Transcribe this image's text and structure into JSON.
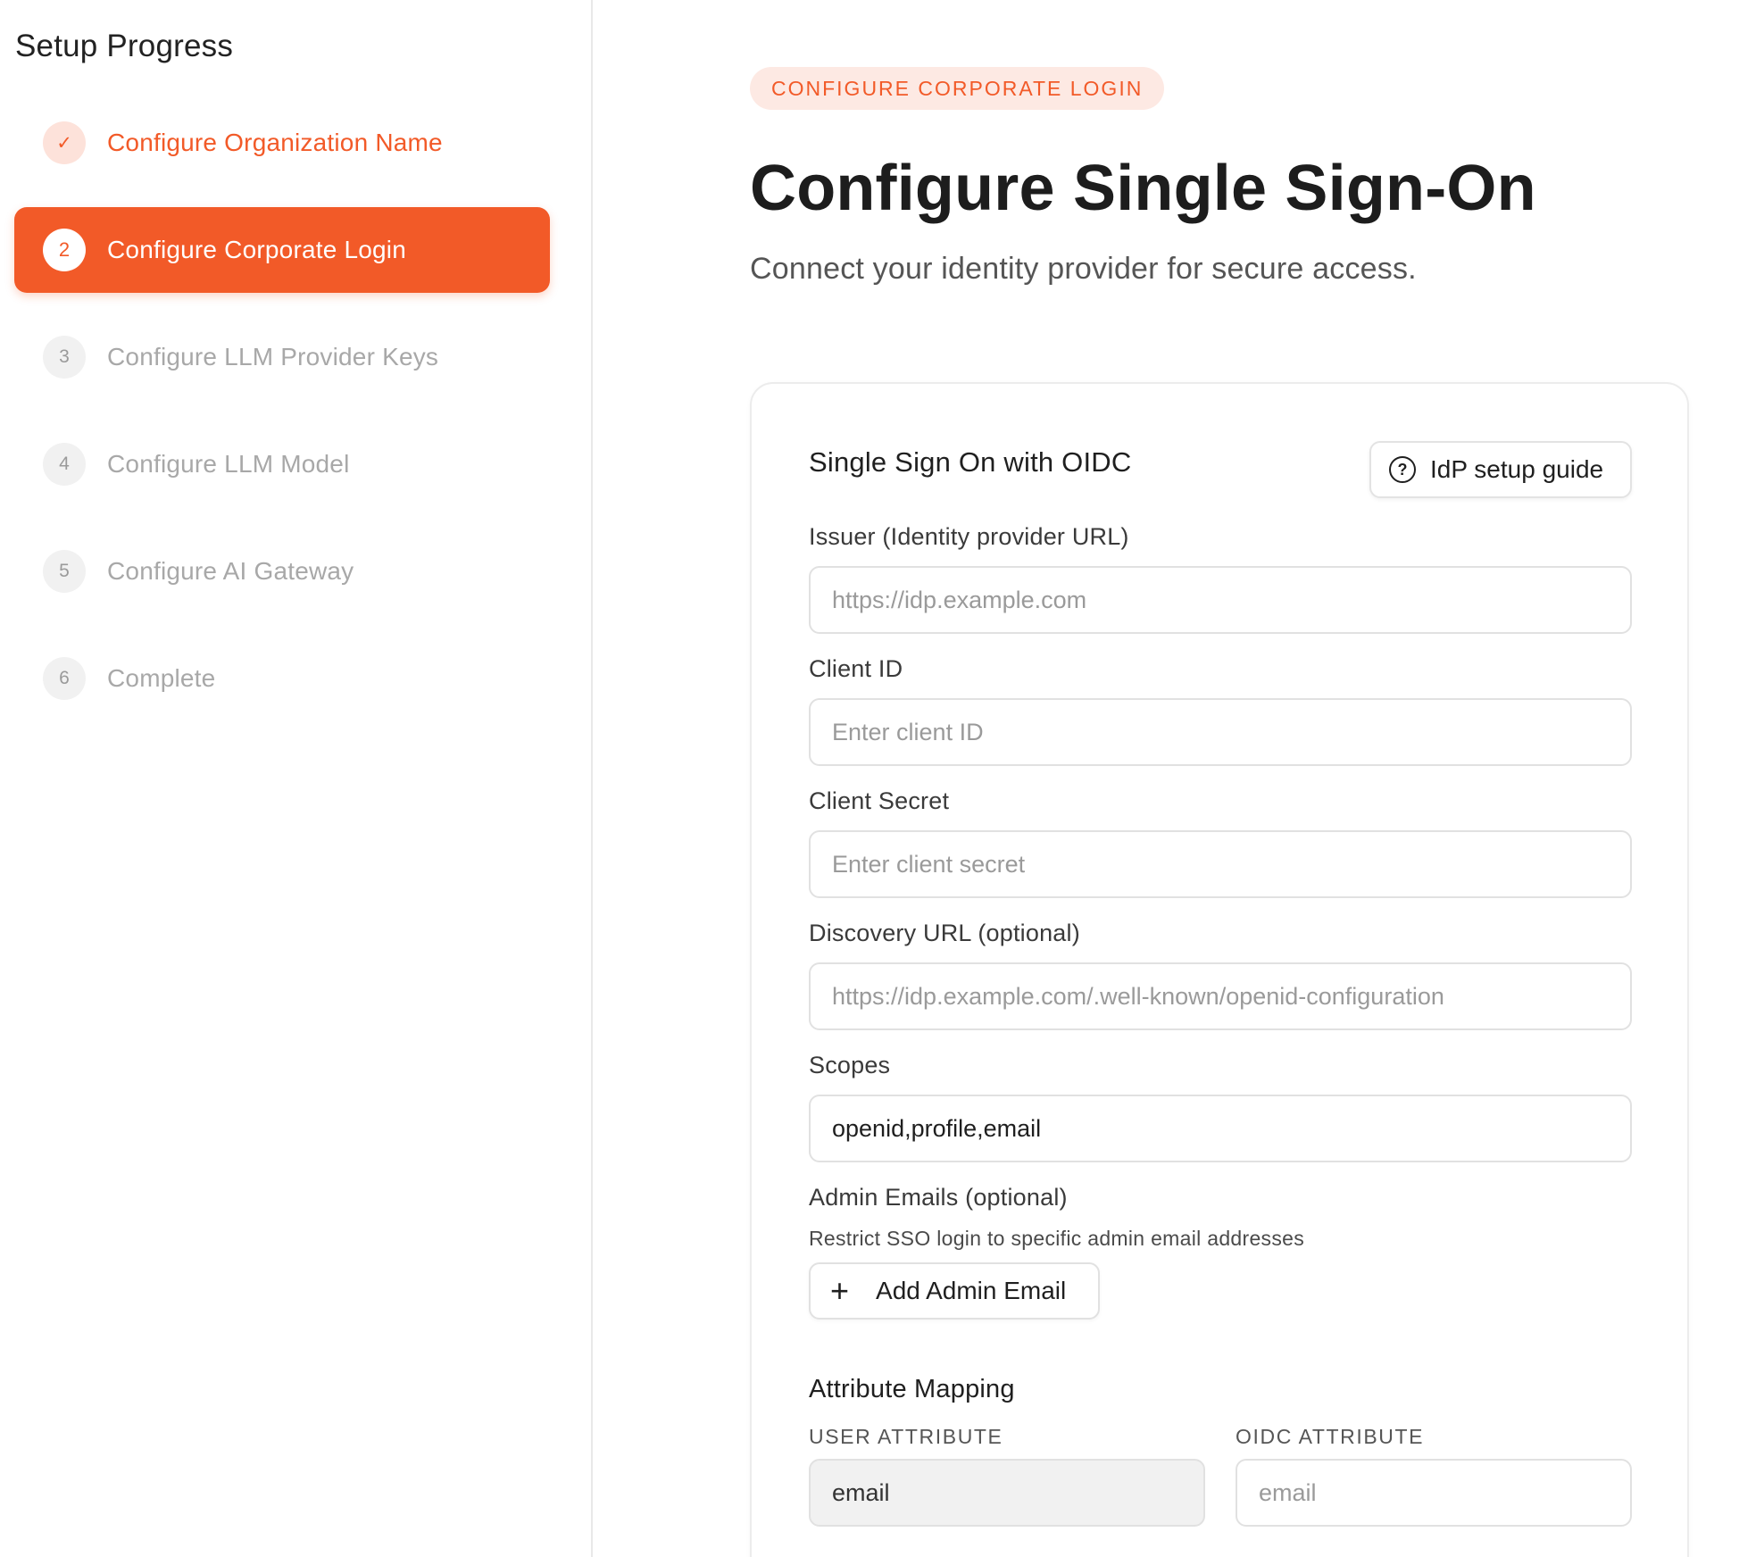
{
  "sidebar": {
    "title": "Setup Progress",
    "steps": [
      {
        "badge": "✓",
        "label": "Configure Organization Name",
        "state": "done"
      },
      {
        "badge": "2",
        "label": "Configure Corporate Login",
        "state": "active"
      },
      {
        "badge": "3",
        "label": "Configure LLM Provider Keys",
        "state": "pending"
      },
      {
        "badge": "4",
        "label": "Configure LLM Model",
        "state": "pending"
      },
      {
        "badge": "5",
        "label": "Configure AI Gateway",
        "state": "pending"
      },
      {
        "badge": "6",
        "label": "Complete",
        "state": "pending"
      }
    ]
  },
  "header": {
    "pill": "CONFIGURE CORPORATE LOGIN",
    "title": "Configure Single Sign-On",
    "subtitle": "Connect your identity provider for secure access."
  },
  "card": {
    "title": "Single Sign On with OIDC",
    "guide_button": "IdP setup guide",
    "guide_icon": "?",
    "fields": {
      "issuer": {
        "label": "Issuer (Identity provider URL)",
        "placeholder": "https://idp.example.com",
        "value": ""
      },
      "client_id": {
        "label": "Client ID",
        "placeholder": "Enter client ID",
        "value": ""
      },
      "client_secret": {
        "label": "Client Secret",
        "placeholder": "Enter client secret",
        "value": ""
      },
      "discovery_url": {
        "label": "Discovery URL (optional)",
        "placeholder": "https://idp.example.com/.well-known/openid-configuration",
        "value": ""
      },
      "scopes": {
        "label": "Scopes",
        "placeholder": "",
        "value": "openid,profile,email"
      }
    },
    "admin_emails": {
      "label": "Admin Emails (optional)",
      "helper": "Restrict SSO login to specific admin email addresses",
      "add_button": "Add Admin Email",
      "add_icon": "+"
    },
    "attribute_mapping": {
      "title": "Attribute Mapping",
      "user_attribute_header": "USER ATTRIBUTE",
      "oidc_attribute_header": "OIDC ATTRIBUTE",
      "rows": [
        {
          "user_attribute": "email",
          "oidc_placeholder": "email"
        }
      ]
    }
  },
  "colors": {
    "accent": "#f25a28",
    "accent_soft": "#fde9e3"
  }
}
